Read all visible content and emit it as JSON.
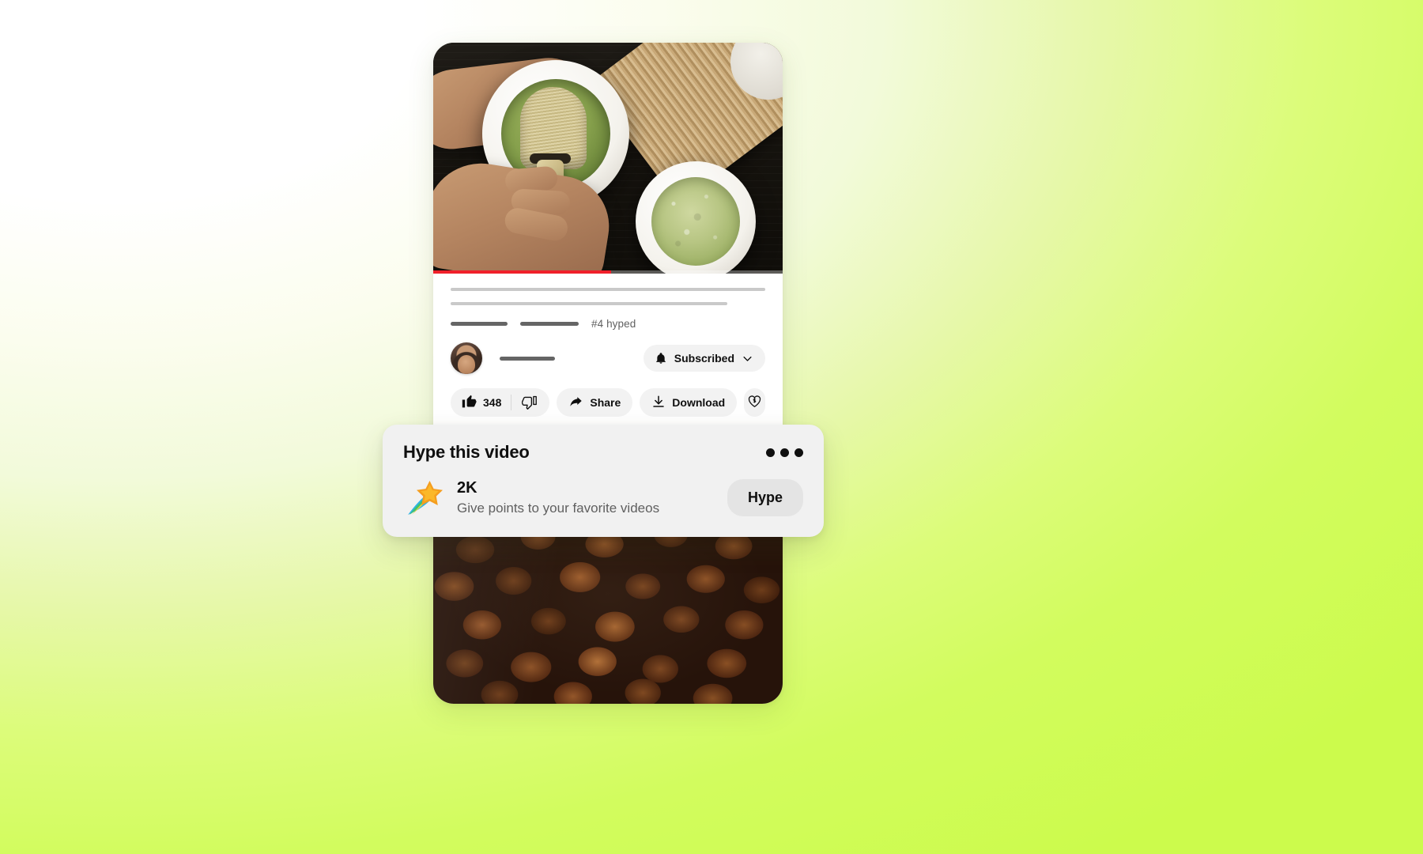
{
  "background": {
    "start_color": "#ffffff",
    "end_color": "#ccfb4c"
  },
  "player": {
    "name": "matcha-preparation-video",
    "progress_percent": 51,
    "progress_color": "#f0202a"
  },
  "video_meta": {
    "title_placeholder_1": "",
    "title_placeholder_2": "",
    "stat_placeholder_1": "",
    "stat_placeholder_2": "",
    "hyped_rank": "#4 hyped"
  },
  "channel": {
    "name_placeholder": "",
    "subscribe_label": "Subscribed",
    "bell_icon": "bell-icon",
    "chevron_icon": "chevron-down-icon",
    "avatar_icon": "channel-avatar"
  },
  "actions": {
    "like_icon": "thumbs-up-icon",
    "like_count": "348",
    "dislike_icon": "thumbs-down-icon",
    "share_icon": "share-arrow-icon",
    "share_label": "Share",
    "download_icon": "download-icon",
    "download_label": "Download",
    "thanks_icon": "heart-dollar-icon"
  },
  "hype_card": {
    "title": "Hype this video",
    "overflow_icon": "more-options-icon",
    "star_icon": "shooting-star-icon",
    "points": "2K",
    "description": "Give points to your favorite videos",
    "button_label": "Hype"
  },
  "bottom_video": {
    "name": "coffee-beans-video"
  }
}
